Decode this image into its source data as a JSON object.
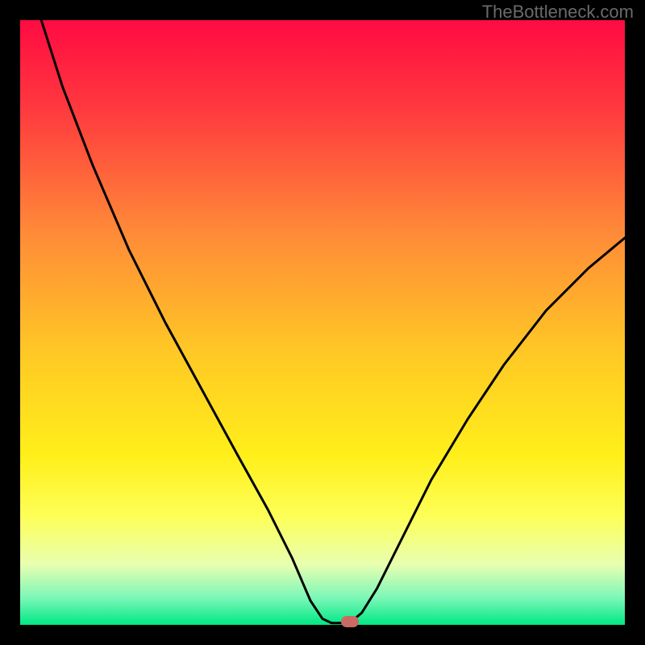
{
  "watermark": "TheBottleneck.com",
  "chart_data": {
    "type": "line",
    "title": "",
    "xlabel": "",
    "ylabel": "",
    "xlim": [
      0,
      100
    ],
    "ylim": [
      0,
      100
    ],
    "gradient_stops": [
      {
        "offset": 0.0,
        "color": "#ff0b42"
      },
      {
        "offset": 0.15,
        "color": "#ff3a3e"
      },
      {
        "offset": 0.35,
        "color": "#ff8a38"
      },
      {
        "offset": 0.55,
        "color": "#ffc825"
      },
      {
        "offset": 0.72,
        "color": "#ffef1a"
      },
      {
        "offset": 0.82,
        "color": "#fdff57"
      },
      {
        "offset": 0.9,
        "color": "#e8ffb0"
      },
      {
        "offset": 0.955,
        "color": "#7cf7b8"
      },
      {
        "offset": 1.0,
        "color": "#00e884"
      }
    ],
    "series": [
      {
        "name": "bottleneck-curve",
        "points": [
          {
            "x": 3.5,
            "y": 100.0
          },
          {
            "x": 7.0,
            "y": 89.0
          },
          {
            "x": 12.0,
            "y": 76.0
          },
          {
            "x": 18.0,
            "y": 62.0
          },
          {
            "x": 24.0,
            "y": 50.0
          },
          {
            "x": 30.0,
            "y": 39.0
          },
          {
            "x": 36.0,
            "y": 28.0
          },
          {
            "x": 41.0,
            "y": 19.0
          },
          {
            "x": 45.0,
            "y": 11.0
          },
          {
            "x": 48.0,
            "y": 4.0
          },
          {
            "x": 50.0,
            "y": 1.0
          },
          {
            "x": 51.5,
            "y": 0.3
          },
          {
            "x": 54.5,
            "y": 0.3
          },
          {
            "x": 56.5,
            "y": 2.0
          },
          {
            "x": 59.0,
            "y": 6.0
          },
          {
            "x": 63.0,
            "y": 14.0
          },
          {
            "x": 68.0,
            "y": 24.0
          },
          {
            "x": 74.0,
            "y": 34.0
          },
          {
            "x": 80.0,
            "y": 43.0
          },
          {
            "x": 87.0,
            "y": 52.0
          },
          {
            "x": 94.0,
            "y": 59.0
          },
          {
            "x": 100.0,
            "y": 64.0
          }
        ]
      }
    ],
    "marker": {
      "x": 54.5,
      "y": 0.5
    }
  }
}
